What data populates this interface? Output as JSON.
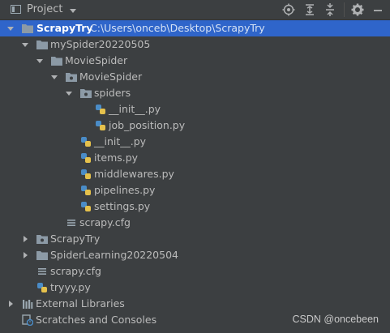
{
  "header": {
    "title": "Project",
    "icons": [
      "project-panel-icon",
      "dropdown-caret-icon",
      "locate-icon",
      "expand-all-icon",
      "collapse-all-icon",
      "settings-gear-icon",
      "hide-panel-icon"
    ]
  },
  "tree": {
    "root": {
      "name": "ScrapyTry",
      "path": "C:\\Users\\onceb\\Desktop\\ScrapyTry"
    },
    "items": [
      {
        "label": "mySpider20220505"
      },
      {
        "label": "MovieSpider"
      },
      {
        "label": "MovieSpider"
      },
      {
        "label": "spiders"
      },
      {
        "label": "__init__.py"
      },
      {
        "label": "job_position.py"
      },
      {
        "label": "__init__.py"
      },
      {
        "label": "items.py"
      },
      {
        "label": "middlewares.py"
      },
      {
        "label": "pipelines.py"
      },
      {
        "label": "settings.py"
      },
      {
        "label": "scrapy.cfg"
      },
      {
        "label": "ScrapyTry"
      },
      {
        "label": "SpiderLearning20220504"
      },
      {
        "label": "scrapy.cfg"
      },
      {
        "label": "tryyy.py"
      },
      {
        "label": "External Libraries"
      },
      {
        "label": "Scratches and Consoles"
      }
    ]
  },
  "watermark": "CSDN @oncebeen",
  "colors": {
    "background": "#3c3f41",
    "selection": "#2f65ca",
    "folder": "#8c9aa6",
    "python_blue": "#4a8cc7",
    "python_yellow": "#e5c14c"
  }
}
